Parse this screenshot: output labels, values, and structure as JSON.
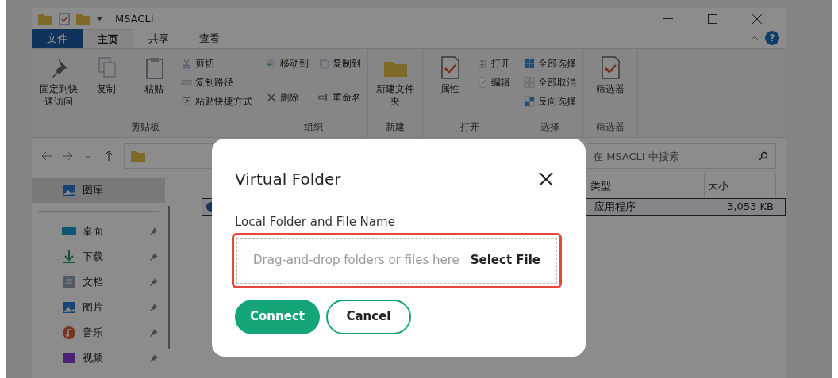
{
  "window": {
    "title": "MSACLI"
  },
  "ribbon_tabs": [
    {
      "label": "文件",
      "kind": "file",
      "selected": false
    },
    {
      "label": "主页",
      "kind": "tab",
      "selected": true
    },
    {
      "label": "共享",
      "kind": "tab",
      "selected": false
    },
    {
      "label": "查看",
      "kind": "tab",
      "selected": false
    }
  ],
  "ribbon_groups": [
    {
      "label": "剪贴板",
      "items": [
        {
          "label": "固定到快速访问",
          "kind": "big"
        },
        {
          "label": "复制",
          "kind": "big"
        },
        {
          "label": "粘贴",
          "kind": "big"
        },
        {
          "label": "剪切",
          "kind": "small"
        },
        {
          "label": "复制路径",
          "kind": "small"
        },
        {
          "label": "粘贴快捷方式",
          "kind": "small"
        }
      ]
    },
    {
      "label": "组织",
      "items": [
        {
          "label": "移动到",
          "kind": "small"
        },
        {
          "label": "复制到",
          "kind": "small"
        },
        {
          "label": "删除",
          "kind": "small"
        },
        {
          "label": "重命名",
          "kind": "small"
        }
      ]
    },
    {
      "label": "新建",
      "items": [
        {
          "label": "新建文件夹",
          "kind": "big"
        }
      ]
    },
    {
      "label": "打开",
      "items": [
        {
          "label": "属性",
          "kind": "big"
        },
        {
          "label": "打开",
          "kind": "small"
        },
        {
          "label": "编辑",
          "kind": "small"
        }
      ]
    },
    {
      "label": "选择",
      "items": [
        {
          "label": "全部选择",
          "kind": "small"
        },
        {
          "label": "全部取消",
          "kind": "small"
        },
        {
          "label": "反向选择",
          "kind": "small"
        }
      ]
    },
    {
      "label": "筛选器",
      "items": [
        {
          "label": "筛选器",
          "kind": "big"
        }
      ]
    }
  ],
  "help": "?",
  "search": {
    "placeholder": "在 MSACLI 中搜索"
  },
  "sidebar": {
    "items": [
      {
        "label": "图库",
        "selected": true,
        "pinned": false
      },
      {
        "label": "桌面",
        "selected": false,
        "pinned": true
      },
      {
        "label": "下载",
        "selected": false,
        "pinned": true
      },
      {
        "label": "文档",
        "selected": false,
        "pinned": true
      },
      {
        "label": "图片",
        "selected": false,
        "pinned": true
      },
      {
        "label": "音乐",
        "selected": false,
        "pinned": true
      },
      {
        "label": "视频",
        "selected": false,
        "pinned": true
      }
    ]
  },
  "table": {
    "columns": [
      "类型",
      "大小"
    ],
    "rows": [
      {
        "cells": [
          "应用程序",
          "3,053 KB"
        ],
        "selected": true
      }
    ]
  },
  "dialog": {
    "title": "Virtual Folder",
    "field_label": "Local Folder and File Name",
    "drop_placeholder": "Drag-and-drop folders or files here",
    "select_button": "Select File",
    "highlighted": true,
    "buttons": [
      {
        "label": "Connect",
        "kind": "primary"
      },
      {
        "label": "Cancel",
        "kind": "secondary"
      }
    ]
  }
}
